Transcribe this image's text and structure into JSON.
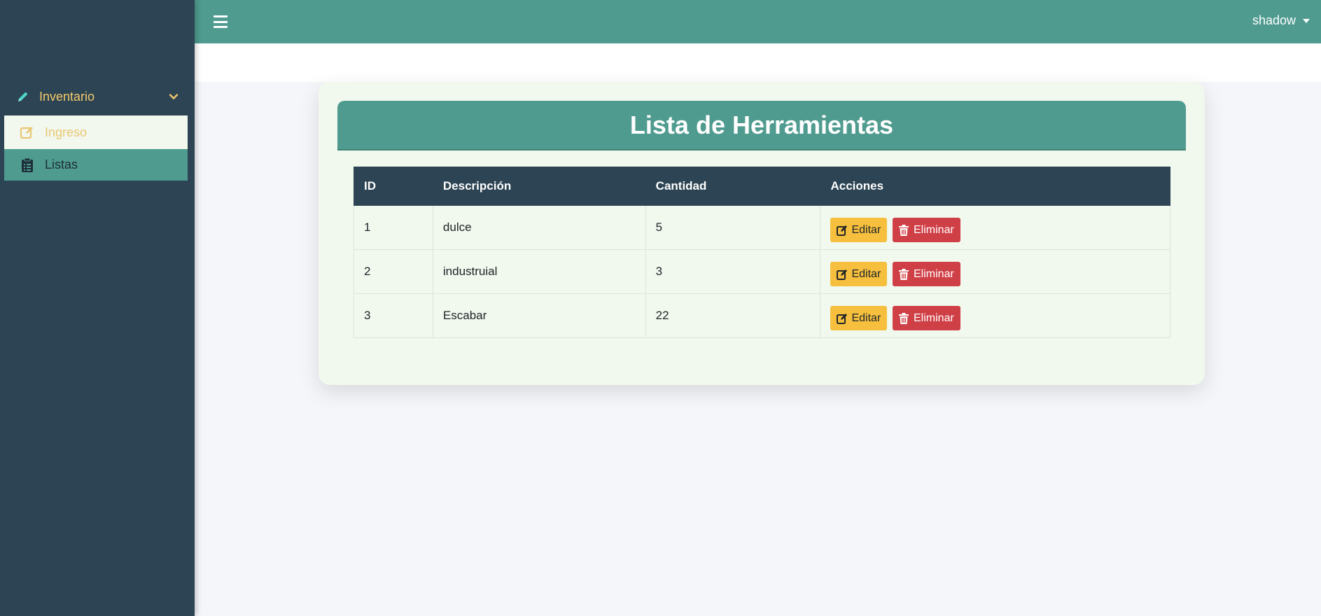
{
  "topbar": {
    "user_name": "shadow"
  },
  "sidebar": {
    "parent": {
      "label": "Inventario",
      "icon": "pencil-icon"
    },
    "items": [
      {
        "label": "Ingreso",
        "icon": "edit-note-icon"
      },
      {
        "label": "Listas",
        "icon": "clipboard-list-icon"
      }
    ]
  },
  "page": {
    "title": "Lista de Herramientas"
  },
  "table": {
    "headers": [
      "ID",
      "Descripción",
      "Cantidad",
      "Acciones"
    ],
    "rows": [
      {
        "id": "1",
        "descripcion": "dulce",
        "cantidad": "5"
      },
      {
        "id": "2",
        "descripcion": "industruial",
        "cantidad": "3"
      },
      {
        "id": "3",
        "descripcion": "Escabar",
        "cantidad": "22"
      }
    ],
    "edit_label": "Editar",
    "delete_label": "Eliminar"
  },
  "colors": {
    "primary": "#4f9b8f",
    "sidebar": "#2c4453",
    "accent_text": "#f4c96b",
    "edit_button": "#f6c03e",
    "delete_button": "#cf3f46"
  }
}
